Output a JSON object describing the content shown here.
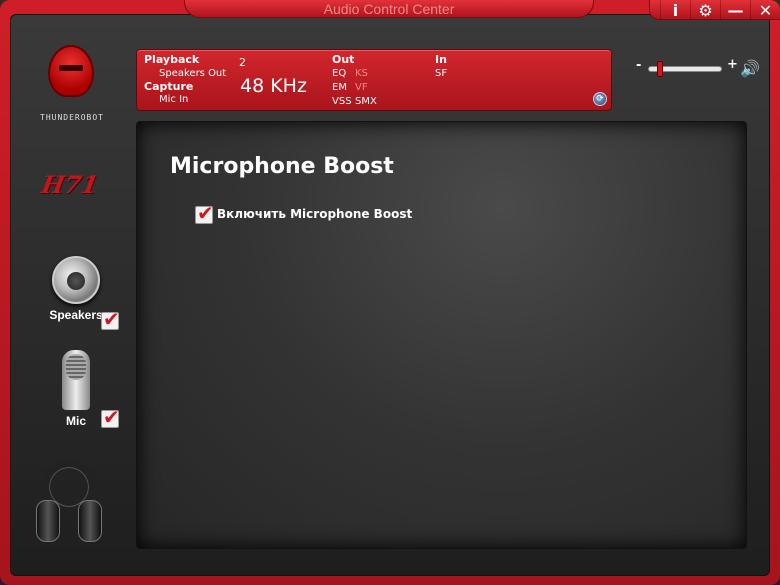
{
  "window": {
    "title": "Audio Control Center",
    "controls": {
      "info": "i",
      "settings": "⚙",
      "minimize": "—",
      "close": "✕"
    }
  },
  "sidebar": {
    "logo_text": "THUNDEROBOT",
    "model": "H71",
    "items": [
      {
        "label": "Speakers",
        "checked": true
      },
      {
        "label": "Mic",
        "checked": true
      }
    ]
  },
  "status": {
    "playback_label": "Playback",
    "playback_device": "Speakers Out",
    "capture_label": "Capture",
    "capture_device": "Mic In",
    "channels": "2",
    "sample_rate": "48 KHz",
    "out_label": "Out",
    "out_eq": "EQ",
    "out_ks": "KS",
    "out_em": "EM",
    "out_vf": "VF",
    "out_vss": "VSS",
    "out_smx": "SMX",
    "in_label": "In",
    "in_sf": "SF",
    "refresh_icon": "⟳"
  },
  "volume": {
    "minus": "-",
    "plus": "+",
    "level": 0.12,
    "icon": "🔊"
  },
  "content": {
    "title": "Microphone Boost",
    "boost_label": "Включить Microphone Boost",
    "boost_checked": true
  },
  "colors": {
    "accent": "#d0161e",
    "panel_bg": "#2e2e2e"
  }
}
